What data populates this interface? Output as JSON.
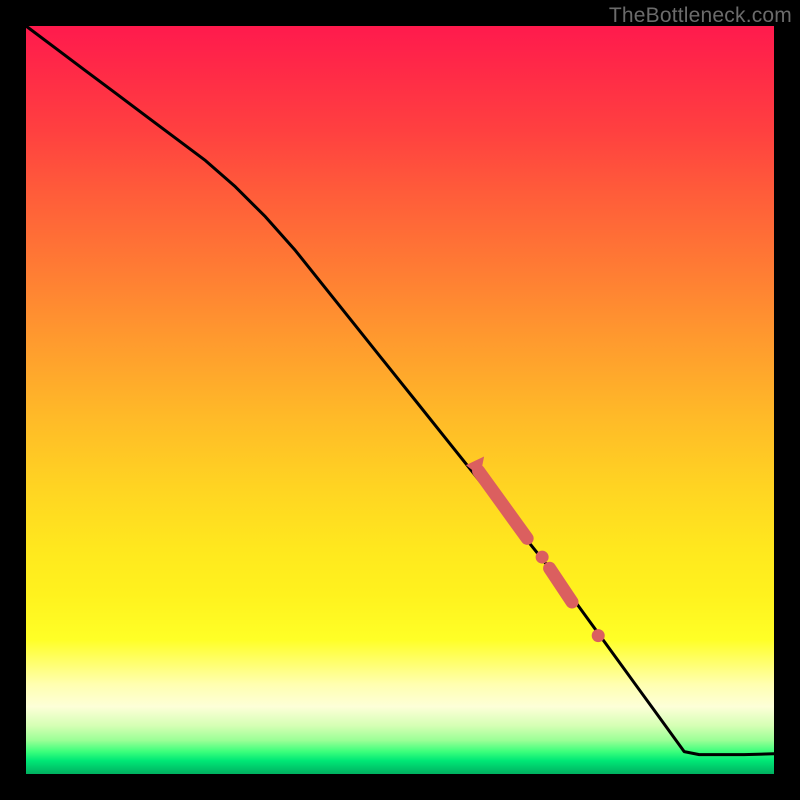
{
  "watermark": "TheBottleneck.com",
  "colors": {
    "line": "#000000",
    "marker": "#db5f5f",
    "gradient_top": "#ff1a4d",
    "gradient_mid": "#ffe81e",
    "gradient_bottom": "#00b060"
  },
  "chart_data": {
    "type": "line",
    "title": "",
    "xlabel": "",
    "ylabel": "",
    "xlim": [
      0,
      100
    ],
    "ylim": [
      0,
      100
    ],
    "grid": false,
    "legend": false,
    "x": [
      0,
      4,
      8,
      12,
      16,
      20,
      24,
      28,
      32,
      36,
      40,
      44,
      48,
      52,
      56,
      60,
      64,
      68,
      72,
      76,
      80,
      84,
      88,
      90,
      92,
      96,
      100
    ],
    "y": [
      100,
      97,
      94,
      91,
      88,
      85,
      82,
      78.5,
      74.5,
      70,
      65,
      60,
      55,
      50,
      45,
      40,
      35,
      30,
      25,
      19.5,
      14,
      8.5,
      3,
      2.6,
      2.6,
      2.6,
      2.7
    ],
    "markers": [
      {
        "kind": "arrow",
        "x": 60.5,
        "y": 41.5,
        "angle_deg": 128
      },
      {
        "kind": "thick",
        "x0": 60.5,
        "y0": 40.5,
        "x1": 67.0,
        "y1": 31.5
      },
      {
        "kind": "dot",
        "x": 69.0,
        "y": 29.0
      },
      {
        "kind": "thick",
        "x0": 70.0,
        "y0": 27.5,
        "x1": 73.0,
        "y1": 23.0
      },
      {
        "kind": "dot",
        "x": 76.5,
        "y": 18.5
      }
    ]
  }
}
